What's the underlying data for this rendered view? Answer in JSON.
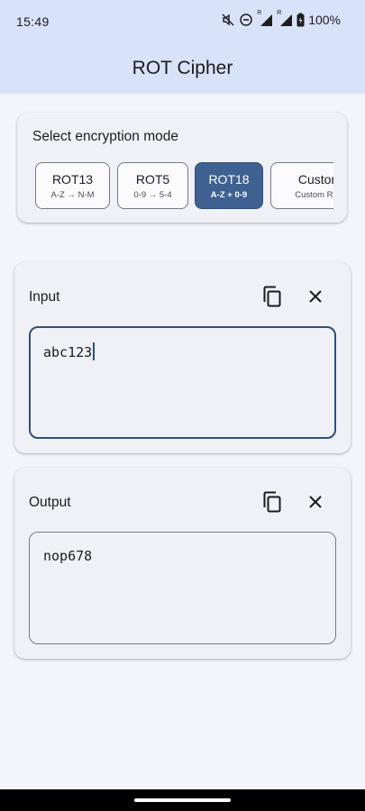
{
  "status_bar": {
    "time": "15:49",
    "signal_1_label": "R",
    "signal_2_label": "R",
    "battery": "100%"
  },
  "app_bar": {
    "title": "ROT Cipher"
  },
  "mode_selector": {
    "title": "Select encryption mode",
    "selected": "ROT18",
    "modes": [
      {
        "name": "ROT13",
        "subtitle": "A-Z → N-M"
      },
      {
        "name": "ROT5",
        "subtitle": "0-9 → 5-4"
      },
      {
        "name": "ROT18",
        "subtitle": "A-Z + 0-9"
      },
      {
        "name": "Custom",
        "subtitle": "Custom ROT"
      }
    ]
  },
  "input_section": {
    "label": "Input",
    "value": "abc123",
    "copy_icon": "copy-icon",
    "clear_icon": "close-icon"
  },
  "output_section": {
    "label": "Output",
    "value": "nop678",
    "copy_icon": "copy-icon",
    "clear_icon": "close-icon"
  },
  "colors": {
    "app_bar": "#d8e2f8",
    "background": "#f3f5fb",
    "accent": "#3e6192",
    "card": "#f0f1f6"
  }
}
